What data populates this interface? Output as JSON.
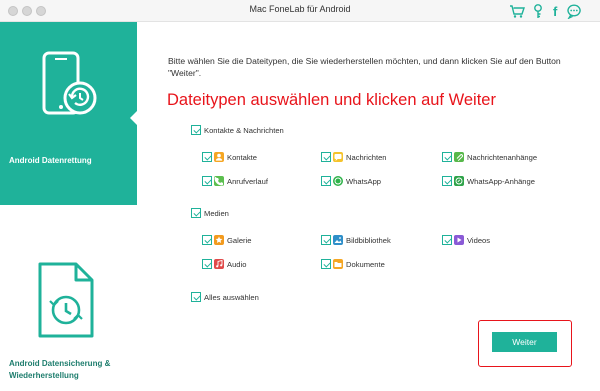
{
  "window": {
    "title": "Mac FoneLab für Android"
  },
  "toolbar": {
    "icons": [
      "cart-icon",
      "key-icon",
      "facebook-icon",
      "chat-icon"
    ],
    "facebook_glyph": "f"
  },
  "sidebar": {
    "items": [
      {
        "label": "Android Datenrettung",
        "icon": "phone-restore-icon",
        "active": true
      },
      {
        "label": "Android Datensicherung & Wiederherstellung",
        "icon": "file-backup-icon",
        "active": false
      }
    ]
  },
  "main": {
    "intro": "Bitte wählen Sie die Dateitypen, die Sie wiederherstellen möchten, und dann klicken Sie auf den Button \"Weiter\".",
    "headline": "Dateitypen auswählen und klicken auf Weiter",
    "groups": [
      {
        "label": "Kontakte & Nachrichten",
        "checked": true,
        "items": [
          {
            "label": "Kontakte",
            "icon": "contacts-icon",
            "color": "#f5a623",
            "checked": true
          },
          {
            "label": "Nachrichten",
            "icon": "messages-icon",
            "color": "#f5c32c",
            "checked": true
          },
          {
            "label": "Nachrichtenanhänge",
            "icon": "attachment-icon",
            "color": "#57b84a",
            "checked": true
          },
          {
            "label": "Anrufverlauf",
            "icon": "call-log-icon",
            "color": "#5cbf4f",
            "checked": true
          },
          {
            "label": "WhatsApp",
            "icon": "whatsapp-icon",
            "color": "#2fb24a",
            "checked": true
          },
          {
            "label": "WhatsApp-Anhänge",
            "icon": "whatsapp-attachment-icon",
            "color": "#2fa34a",
            "checked": true
          }
        ]
      },
      {
        "label": "Medien",
        "checked": true,
        "items": [
          {
            "label": "Galerie",
            "icon": "gallery-icon",
            "color": "#f29a1e",
            "checked": true
          },
          {
            "label": "Bildbibliothek",
            "icon": "picture-library-icon",
            "color": "#2f8fc9",
            "checked": true
          },
          {
            "label": "Videos",
            "icon": "videos-icon",
            "color": "#8a5ad6",
            "checked": true
          },
          {
            "label": "Audio",
            "icon": "audio-icon",
            "color": "#e04a4a",
            "checked": true
          },
          {
            "label": "Dokumente",
            "icon": "documents-icon",
            "color": "#f5a623",
            "checked": true
          }
        ]
      }
    ],
    "select_all": {
      "label": "Alles auswählen",
      "checked": true
    },
    "next_button": "Weiter"
  },
  "colors": {
    "accent": "#1fb29a",
    "headline": "#e8141b",
    "highlight": "#e8141b"
  }
}
